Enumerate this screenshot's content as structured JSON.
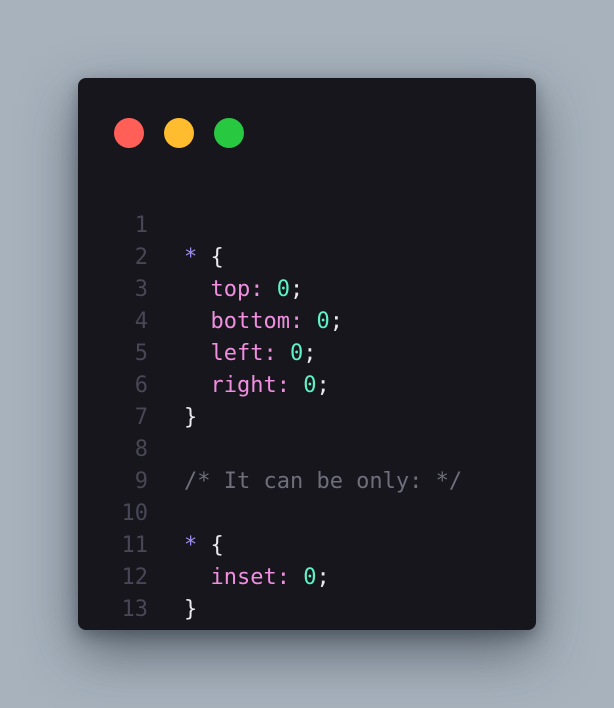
{
  "window_controls": {
    "close_color": "#ff5f57",
    "minimize_color": "#febc2e",
    "maximize_color": "#28c840"
  },
  "code": {
    "lines": [
      {
        "number": "1",
        "selector": "*",
        "brace": " {"
      },
      {
        "number": "2",
        "indent": "  ",
        "property": "top",
        "colon": ": ",
        "value": "0",
        "semicolon": ";"
      },
      {
        "number": "3",
        "indent": "  ",
        "property": "bottom",
        "colon": ": ",
        "value": "0",
        "semicolon": ";"
      },
      {
        "number": "4",
        "indent": "  ",
        "property": "left",
        "colon": ": ",
        "value": "0",
        "semicolon": ";"
      },
      {
        "number": "5",
        "indent": "  ",
        "property": "right",
        "colon": ": ",
        "value": "0",
        "semicolon": ";"
      },
      {
        "number": "6",
        "brace": "}"
      },
      {
        "number": "7"
      },
      {
        "number": "8",
        "comment": "/* It can be only: */"
      },
      {
        "number": "9"
      },
      {
        "number": "10",
        "selector": "*",
        "brace": " {"
      },
      {
        "number": "11",
        "indent": "  ",
        "property": "inset",
        "colon": ": ",
        "value": "0",
        "semicolon": ";"
      },
      {
        "number": "12",
        "brace": "}"
      },
      {
        "number": "13"
      }
    ]
  }
}
